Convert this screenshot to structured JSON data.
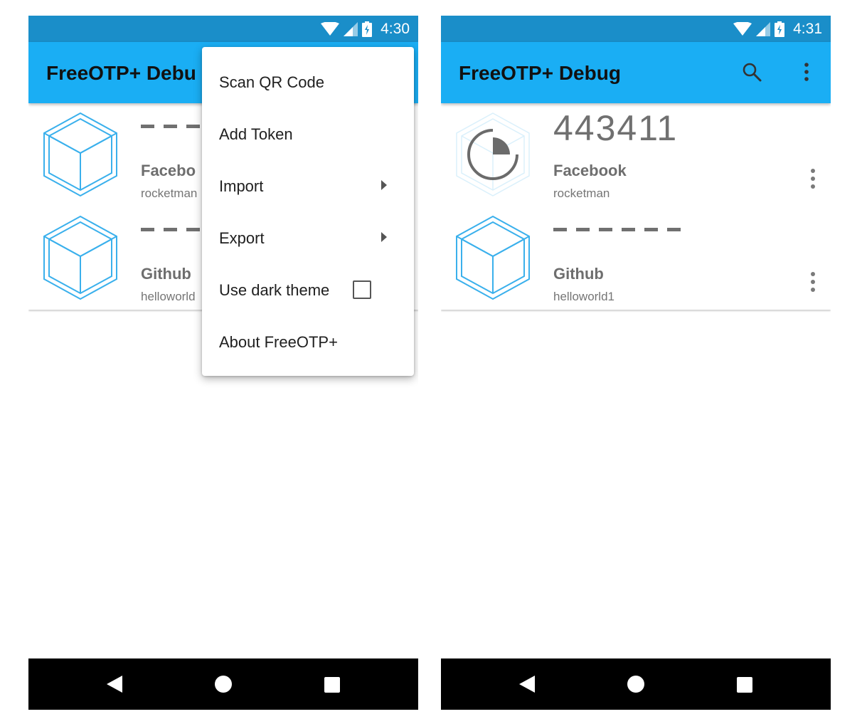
{
  "left_screen": {
    "status": {
      "time": "4:30"
    },
    "app_title": "FreeOTP+ Debu",
    "tokens": [
      {
        "issuer": "Facebo",
        "label": "rocketman"
      },
      {
        "issuer": "Github",
        "label": "helloworld"
      }
    ],
    "menu": {
      "scan_qr": "Scan QR Code",
      "add_token": "Add Token",
      "import": "Import",
      "export": "Export",
      "dark_theme": "Use dark theme",
      "dark_theme_checked": false,
      "about": "About FreeOTP+"
    }
  },
  "right_screen": {
    "status": {
      "time": "4:31"
    },
    "app_title": "FreeOTP+ Debug",
    "icons": [
      "search-icon",
      "overflow-menu-icon"
    ],
    "tokens": [
      {
        "code": "443411",
        "issuer": "Facebook",
        "label": "rocketman",
        "timer_remaining_fraction": 0.75
      },
      {
        "code": "",
        "issuer": "Github",
        "label": "helloworld1"
      }
    ]
  },
  "colors": {
    "status_bar": "#1a8ec9",
    "app_bar": "#1aaef4",
    "cube": "#3ab0ec",
    "nav_bar": "#000000"
  }
}
